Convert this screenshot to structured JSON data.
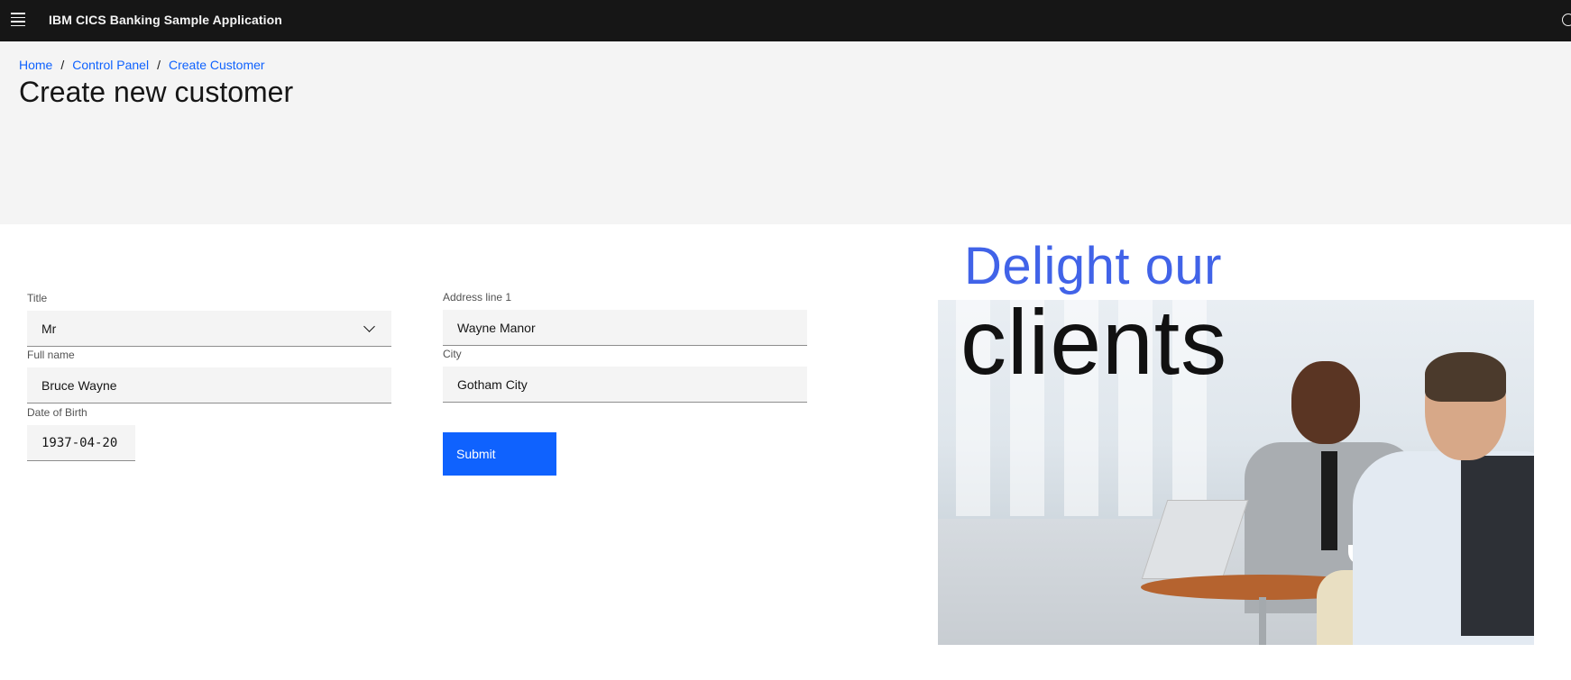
{
  "header": {
    "app_title": "IBM CICS Banking Sample Application"
  },
  "breadcrumb": {
    "items": [
      "Home",
      "Control Panel",
      "Create Customer"
    ],
    "separator": "/"
  },
  "page": {
    "title": "Create new customer"
  },
  "form": {
    "title_field": {
      "label": "Title",
      "value": "Mr"
    },
    "full_name": {
      "label": "Full name",
      "value": "Bruce Wayne"
    },
    "date_of_birth": {
      "label": "Date of Birth",
      "value": "1937-04-20"
    },
    "address_line_1": {
      "label": "Address line 1",
      "value": "Wayne Manor"
    },
    "city": {
      "label": "City",
      "value": "Gotham City"
    },
    "submit_label": "Submit"
  },
  "hero": {
    "line1": "Delight our",
    "line2": "clients"
  },
  "colors": {
    "header_bg": "#161616",
    "banner_bg": "#f4f4f4",
    "accent": "#0f62fe",
    "hero_blue": "#4163e8"
  }
}
